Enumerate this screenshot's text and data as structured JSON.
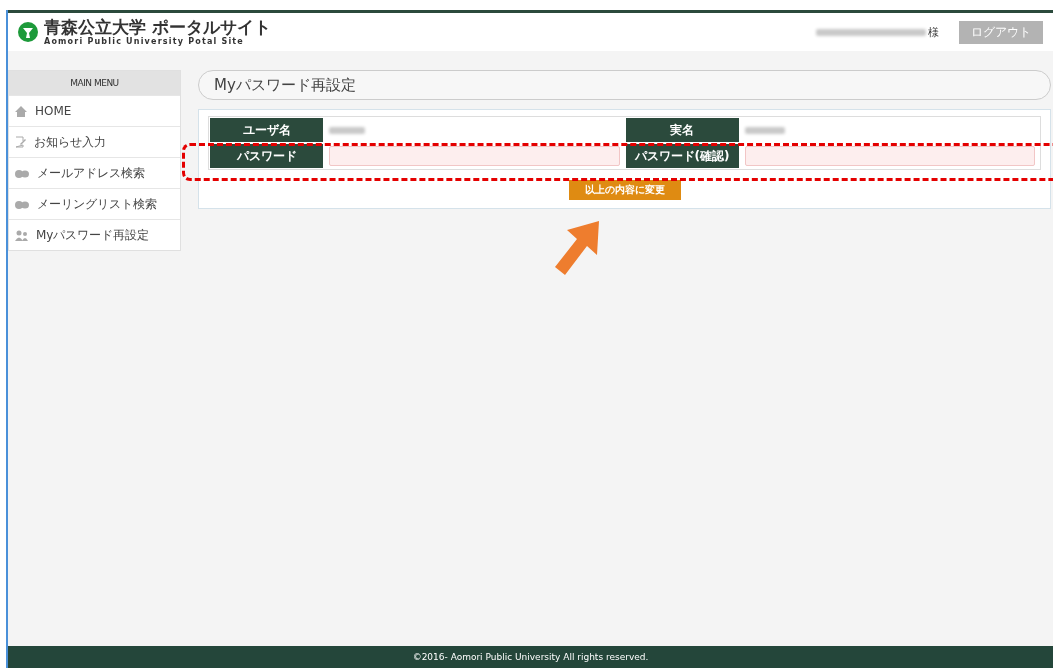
{
  "header": {
    "title": "青森公立大学 ポータルサイト",
    "subtitle": "Aomori Public University Potal Site",
    "user_suffix": "様",
    "logout": "ログアウト"
  },
  "sidebar": {
    "heading": "MAIN MENU",
    "items": [
      {
        "label": "HOME",
        "kind": "home"
      },
      {
        "label": "お知らせ入力",
        "kind": "note"
      },
      {
        "label": "メールアドレス検索",
        "kind": "people"
      },
      {
        "label": "メーリングリスト検索",
        "kind": "people"
      },
      {
        "label": "Myパスワード再設定",
        "kind": "user"
      }
    ]
  },
  "page_title": "Myパスワード再設定",
  "form": {
    "rows": [
      [
        {
          "label": "ユーザ名",
          "kind": "blurred"
        },
        {
          "label": "実名",
          "kind": "blurred"
        }
      ],
      [
        {
          "label": "パスワード",
          "kind": "input"
        },
        {
          "label": "パスワード(確認)",
          "kind": "input"
        }
      ]
    ],
    "submit": "以上の内容に変更"
  },
  "footer": "©2016- Aomori Public University All rights reserved."
}
